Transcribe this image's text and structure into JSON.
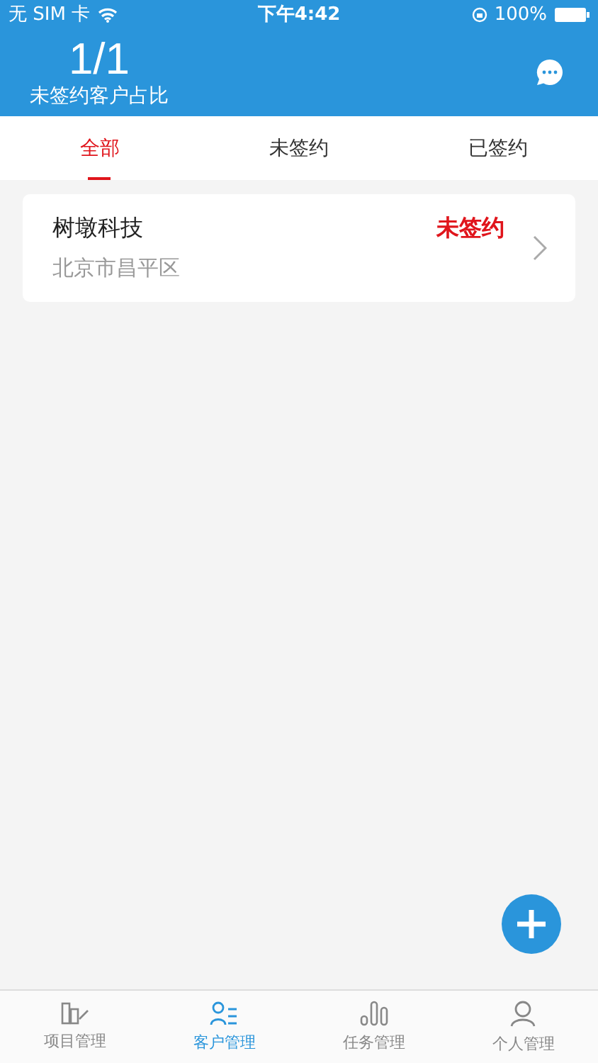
{
  "status_bar": {
    "carrier": "无 SIM 卡",
    "time": "下午4:42",
    "battery": "100%"
  },
  "header": {
    "ratio": "1/1",
    "caption": "未签约客户占比"
  },
  "tabs": [
    {
      "label": "全部",
      "selected": true
    },
    {
      "label": "未签约",
      "selected": false
    },
    {
      "label": "已签约",
      "selected": false
    }
  ],
  "customers": [
    {
      "name": "树墩科技",
      "status": "未签约",
      "signed": false,
      "address": "北京市昌平区"
    }
  ],
  "bottom_nav": [
    {
      "label": "项目管理",
      "kind": "project",
      "selected": false
    },
    {
      "label": "客户管理",
      "kind": "customer",
      "selected": true
    },
    {
      "label": "任务管理",
      "kind": "task",
      "selected": false
    },
    {
      "label": "个人管理",
      "kind": "person",
      "selected": false
    }
  ]
}
